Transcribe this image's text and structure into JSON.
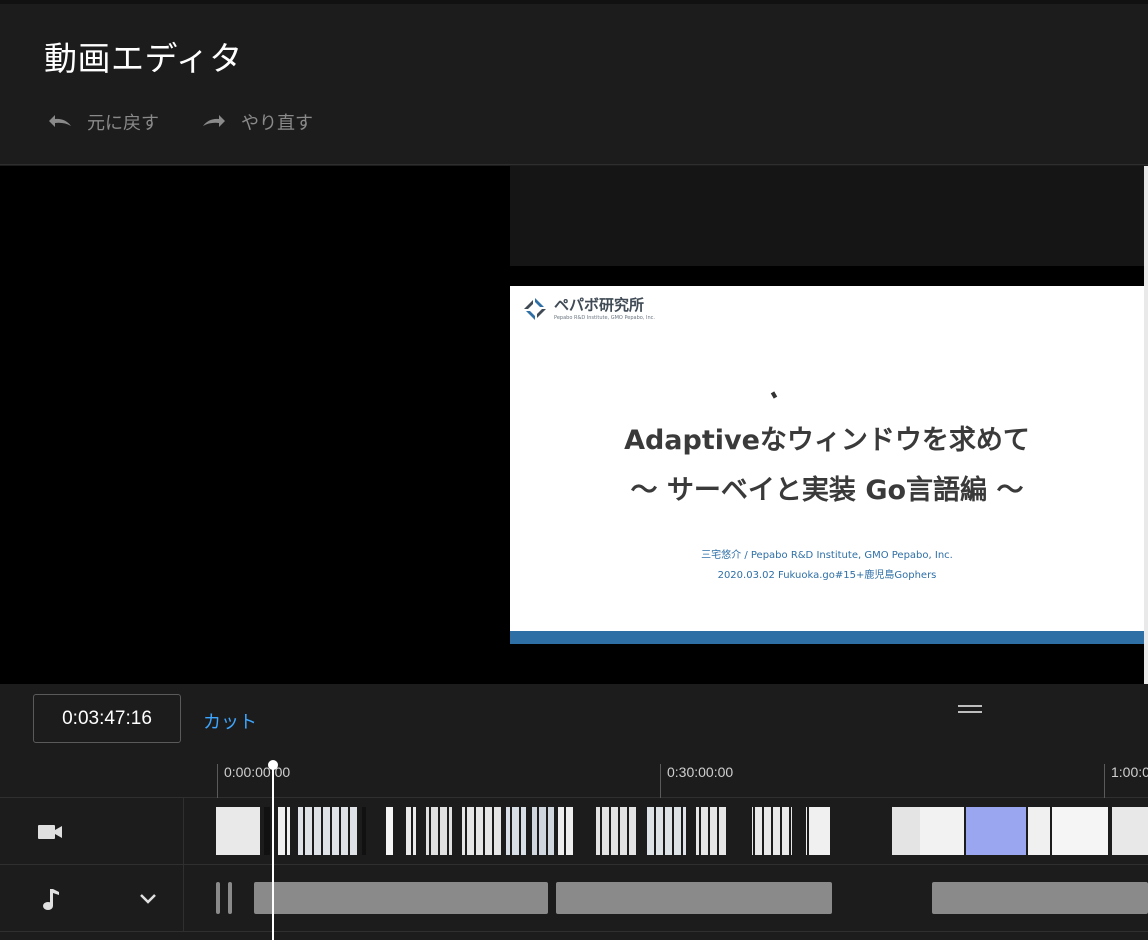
{
  "header": {
    "title": "動画エディタ",
    "undo_label": "元に戻す",
    "redo_label": "やり直す"
  },
  "preview": {
    "slide": {
      "logo_text": "ペパボ研究所",
      "logo_sub": "Pepabo R&D Institute, GMO Pepabo, Inc.",
      "title_line1": "Adaptiveなウィンドウを求めて",
      "title_line2": "〜 サーベイと実装 Go言語編 〜",
      "author": "三宅悠介 / Pepabo R&D Institute, GMO Pepabo, Inc.",
      "event": "2020.03.02 Fukuoka.go#15+鹿児島Gophers"
    }
  },
  "controls": {
    "timecode": "0:03:47:16",
    "cut_label": "カット"
  },
  "ruler": {
    "labels": [
      "0:00:00:00",
      "0:30:00:00",
      "1:00:0"
    ]
  },
  "tracks": {
    "video_icon": "video-camera-icon",
    "audio_icon": "music-note-icon",
    "expand_icon": "chevron-down-icon"
  },
  "colors": {
    "background": "#1c1c1c",
    "accent": "#3ea6ff",
    "slide_accent": "#2e6fa6",
    "waveform": "#8a8a8a"
  }
}
